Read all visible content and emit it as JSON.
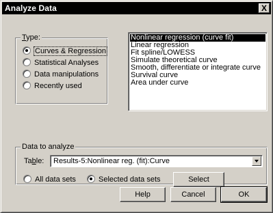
{
  "window": {
    "title": "Analyze Data",
    "close_glyph": "X"
  },
  "type_group": {
    "legend": "Type:",
    "options": [
      {
        "label": "Curves & Regression",
        "selected": true
      },
      {
        "label": "Statistical Analyses",
        "selected": false
      },
      {
        "label": "Data manipulations",
        "selected": false
      },
      {
        "label": "Recently used",
        "selected": false
      }
    ]
  },
  "analysis_list": {
    "items": [
      "Nonlinear regression (curve fit)",
      "Linear regression",
      "Fit spline/LOWESS",
      "Simulate theoretical curve",
      "Smooth, differentiate or integrate curve",
      "Survival curve",
      "Area under curve"
    ],
    "selected_index": 0
  },
  "data_group": {
    "legend": "Data to analyze",
    "table_label": "Table:",
    "table_value": "Results-5:Nonlinear reg. (fit):Curve",
    "all_label": "All data sets",
    "selected_label": "Selected data sets",
    "select_button": "Select"
  },
  "buttons": {
    "help": "Help",
    "cancel": "Cancel",
    "ok": "OK"
  },
  "colors": {
    "dialog_face": "#d4d0c8",
    "titlebar": "#000000",
    "selection": "#000000"
  }
}
